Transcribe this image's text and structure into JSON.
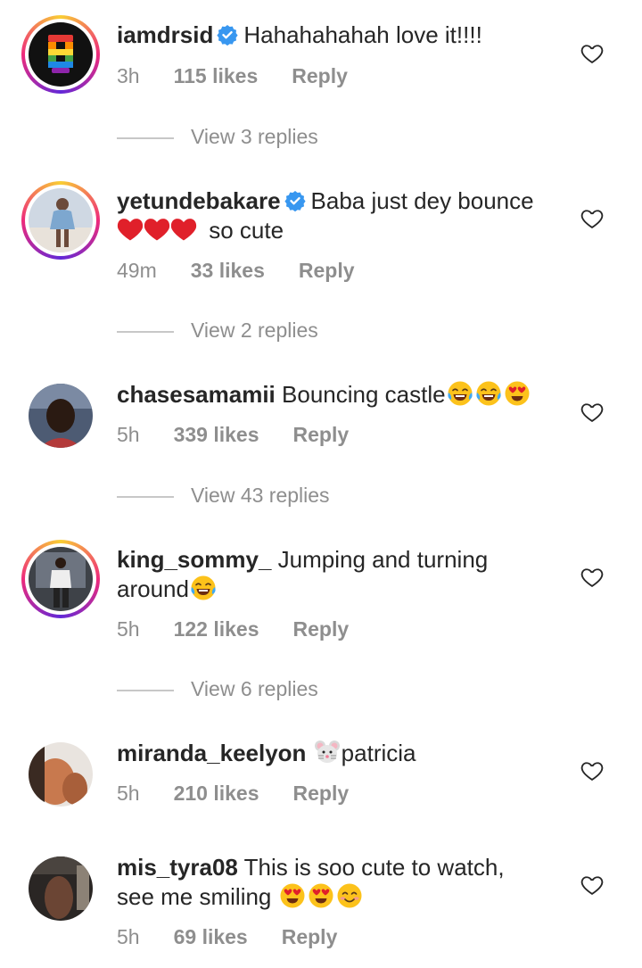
{
  "comments": [
    {
      "username": "iamdrsid",
      "verified": true,
      "text": "Hahahahahah love it!!!!",
      "time": "3h",
      "likes": "115 likes",
      "reply": "Reply",
      "view_replies": "View 3 replies"
    },
    {
      "username": "yetundebakare",
      "verified": true,
      "text_line1": "Baba just dey bounce",
      "text_line2": "so cute",
      "time": "49m",
      "likes": "33 likes",
      "reply": "Reply",
      "view_replies": "View 2 replies"
    },
    {
      "username": "chasesamamii",
      "verified": false,
      "text": "Bouncing castle",
      "time": "5h",
      "likes": "339 likes",
      "reply": "Reply",
      "view_replies": "View 43 replies"
    },
    {
      "username": "king_sommy_",
      "verified": false,
      "text_line1": "Jumping and turning",
      "text_line2": "around",
      "time": "5h",
      "likes": "122 likes",
      "reply": "Reply",
      "view_replies": "View 6 replies"
    },
    {
      "username": "miranda_keelyon",
      "verified": false,
      "text": "patricia",
      "time": "5h",
      "likes": "210 likes",
      "reply": "Reply"
    },
    {
      "username": "mis_tyra08",
      "verified": false,
      "text_line1": "This is soo cute to watch,",
      "text_line2": "see me smiling",
      "time": "5h",
      "likes": "69 likes",
      "reply": "Reply"
    }
  ],
  "colors": {
    "text": "#262626",
    "muted": "#8e8e8e",
    "verified": "#3897f0",
    "heart_red": "#e0202a"
  },
  "icons": {
    "like": "heart-outline-icon",
    "verified": "verified-badge-icon",
    "emoji_laugh": "face-with-tears-of-joy",
    "emoji_heart_eyes": "smiling-face-with-heart-eyes",
    "emoji_blush": "smiling-face-with-smiling-eyes",
    "emoji_mouse": "mouse-face",
    "red_heart": "red-heart"
  }
}
